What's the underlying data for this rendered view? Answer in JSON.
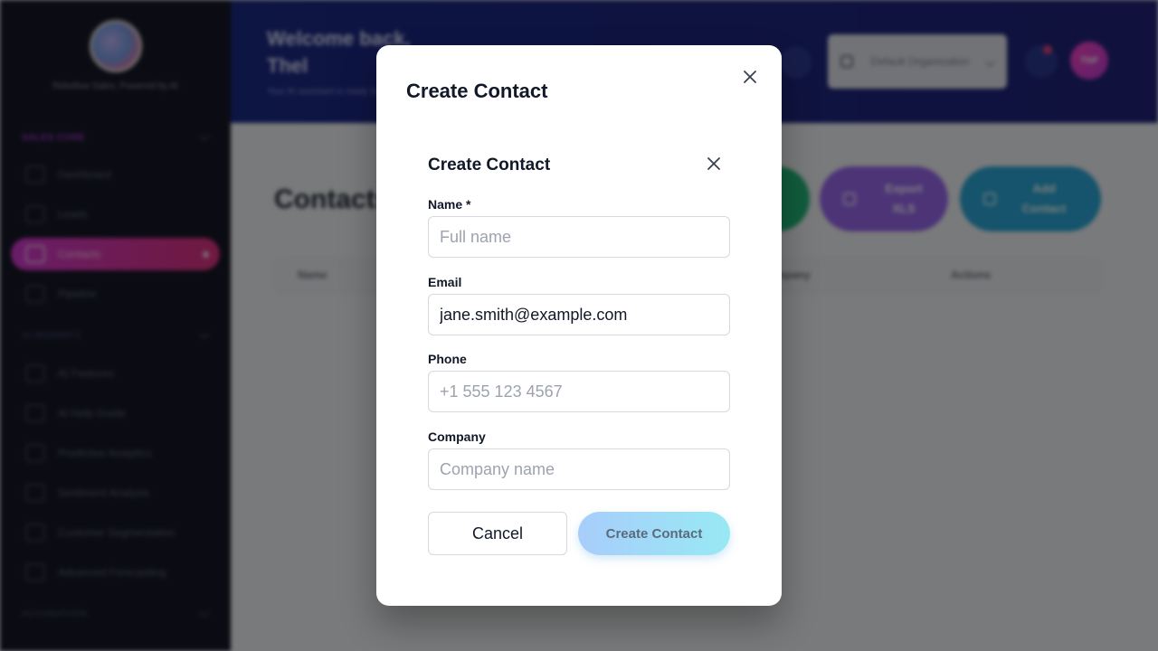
{
  "sidebar": {
    "brand": "Rebellow Sales, Powered by AI",
    "sections": [
      {
        "title": "SALES CORE",
        "color": "#a43ad0",
        "items": [
          {
            "label": "Dashboard",
            "active": false
          },
          {
            "label": "Leads",
            "active": false
          },
          {
            "label": "Contacts",
            "active": true
          },
          {
            "label": "Pipeline",
            "active": false
          }
        ]
      },
      {
        "title": "AI INSIGHTS",
        "color": "#3b4060",
        "items": [
          {
            "label": "AI Features",
            "active": false
          },
          {
            "label": "AI Help Guide",
            "active": false
          },
          {
            "label": "Predictive Analytics",
            "active": false
          },
          {
            "label": "Sentiment Analysis",
            "active": false
          },
          {
            "label": "Customer Segmentation",
            "active": false
          },
          {
            "label": "Advanced Forecasting",
            "active": false
          }
        ]
      },
      {
        "title": "AUTOMATION",
        "color": "#3b4060",
        "items": []
      }
    ]
  },
  "header": {
    "welcome": "Welcome back, Thel",
    "subtitle": "Your AI assistant is ready to help",
    "org_select": "Default Organization",
    "avatar_initials": "TNP"
  },
  "page": {
    "title": "Contacts",
    "buttons": [
      "",
      "Export XLS",
      "Add Contact"
    ],
    "table_headers": [
      "Name",
      "Company",
      "Actions"
    ]
  },
  "modal": {
    "title": "Create Contact",
    "inner_title": "Create Contact",
    "fields": {
      "name": {
        "label": "Name *",
        "value": "",
        "placeholder": "Full name"
      },
      "email": {
        "label": "Email",
        "value": "jane.smith@example.com",
        "placeholder": ""
      },
      "phone": {
        "label": "Phone",
        "value": "",
        "placeholder": "+1 555 123 4567"
      },
      "company": {
        "label": "Company",
        "value": "",
        "placeholder": "Company name"
      }
    },
    "cancel_label": "Cancel",
    "submit_label": "Create Contact"
  },
  "colors": {
    "sidebar_bg": "#161827",
    "header_bg": "#1b2a86",
    "active_nav": "#d23bd0",
    "submit_gradient_start": "#a8cdfb",
    "submit_gradient_end": "#98e9f4"
  },
  "icons": [
    "close-icon",
    "dashboard-icon",
    "leads-icon",
    "contacts-icon",
    "pipeline-icon",
    "bell-icon",
    "theme-toggle-icon",
    "organization-icon",
    "chevron-down-icon"
  ]
}
